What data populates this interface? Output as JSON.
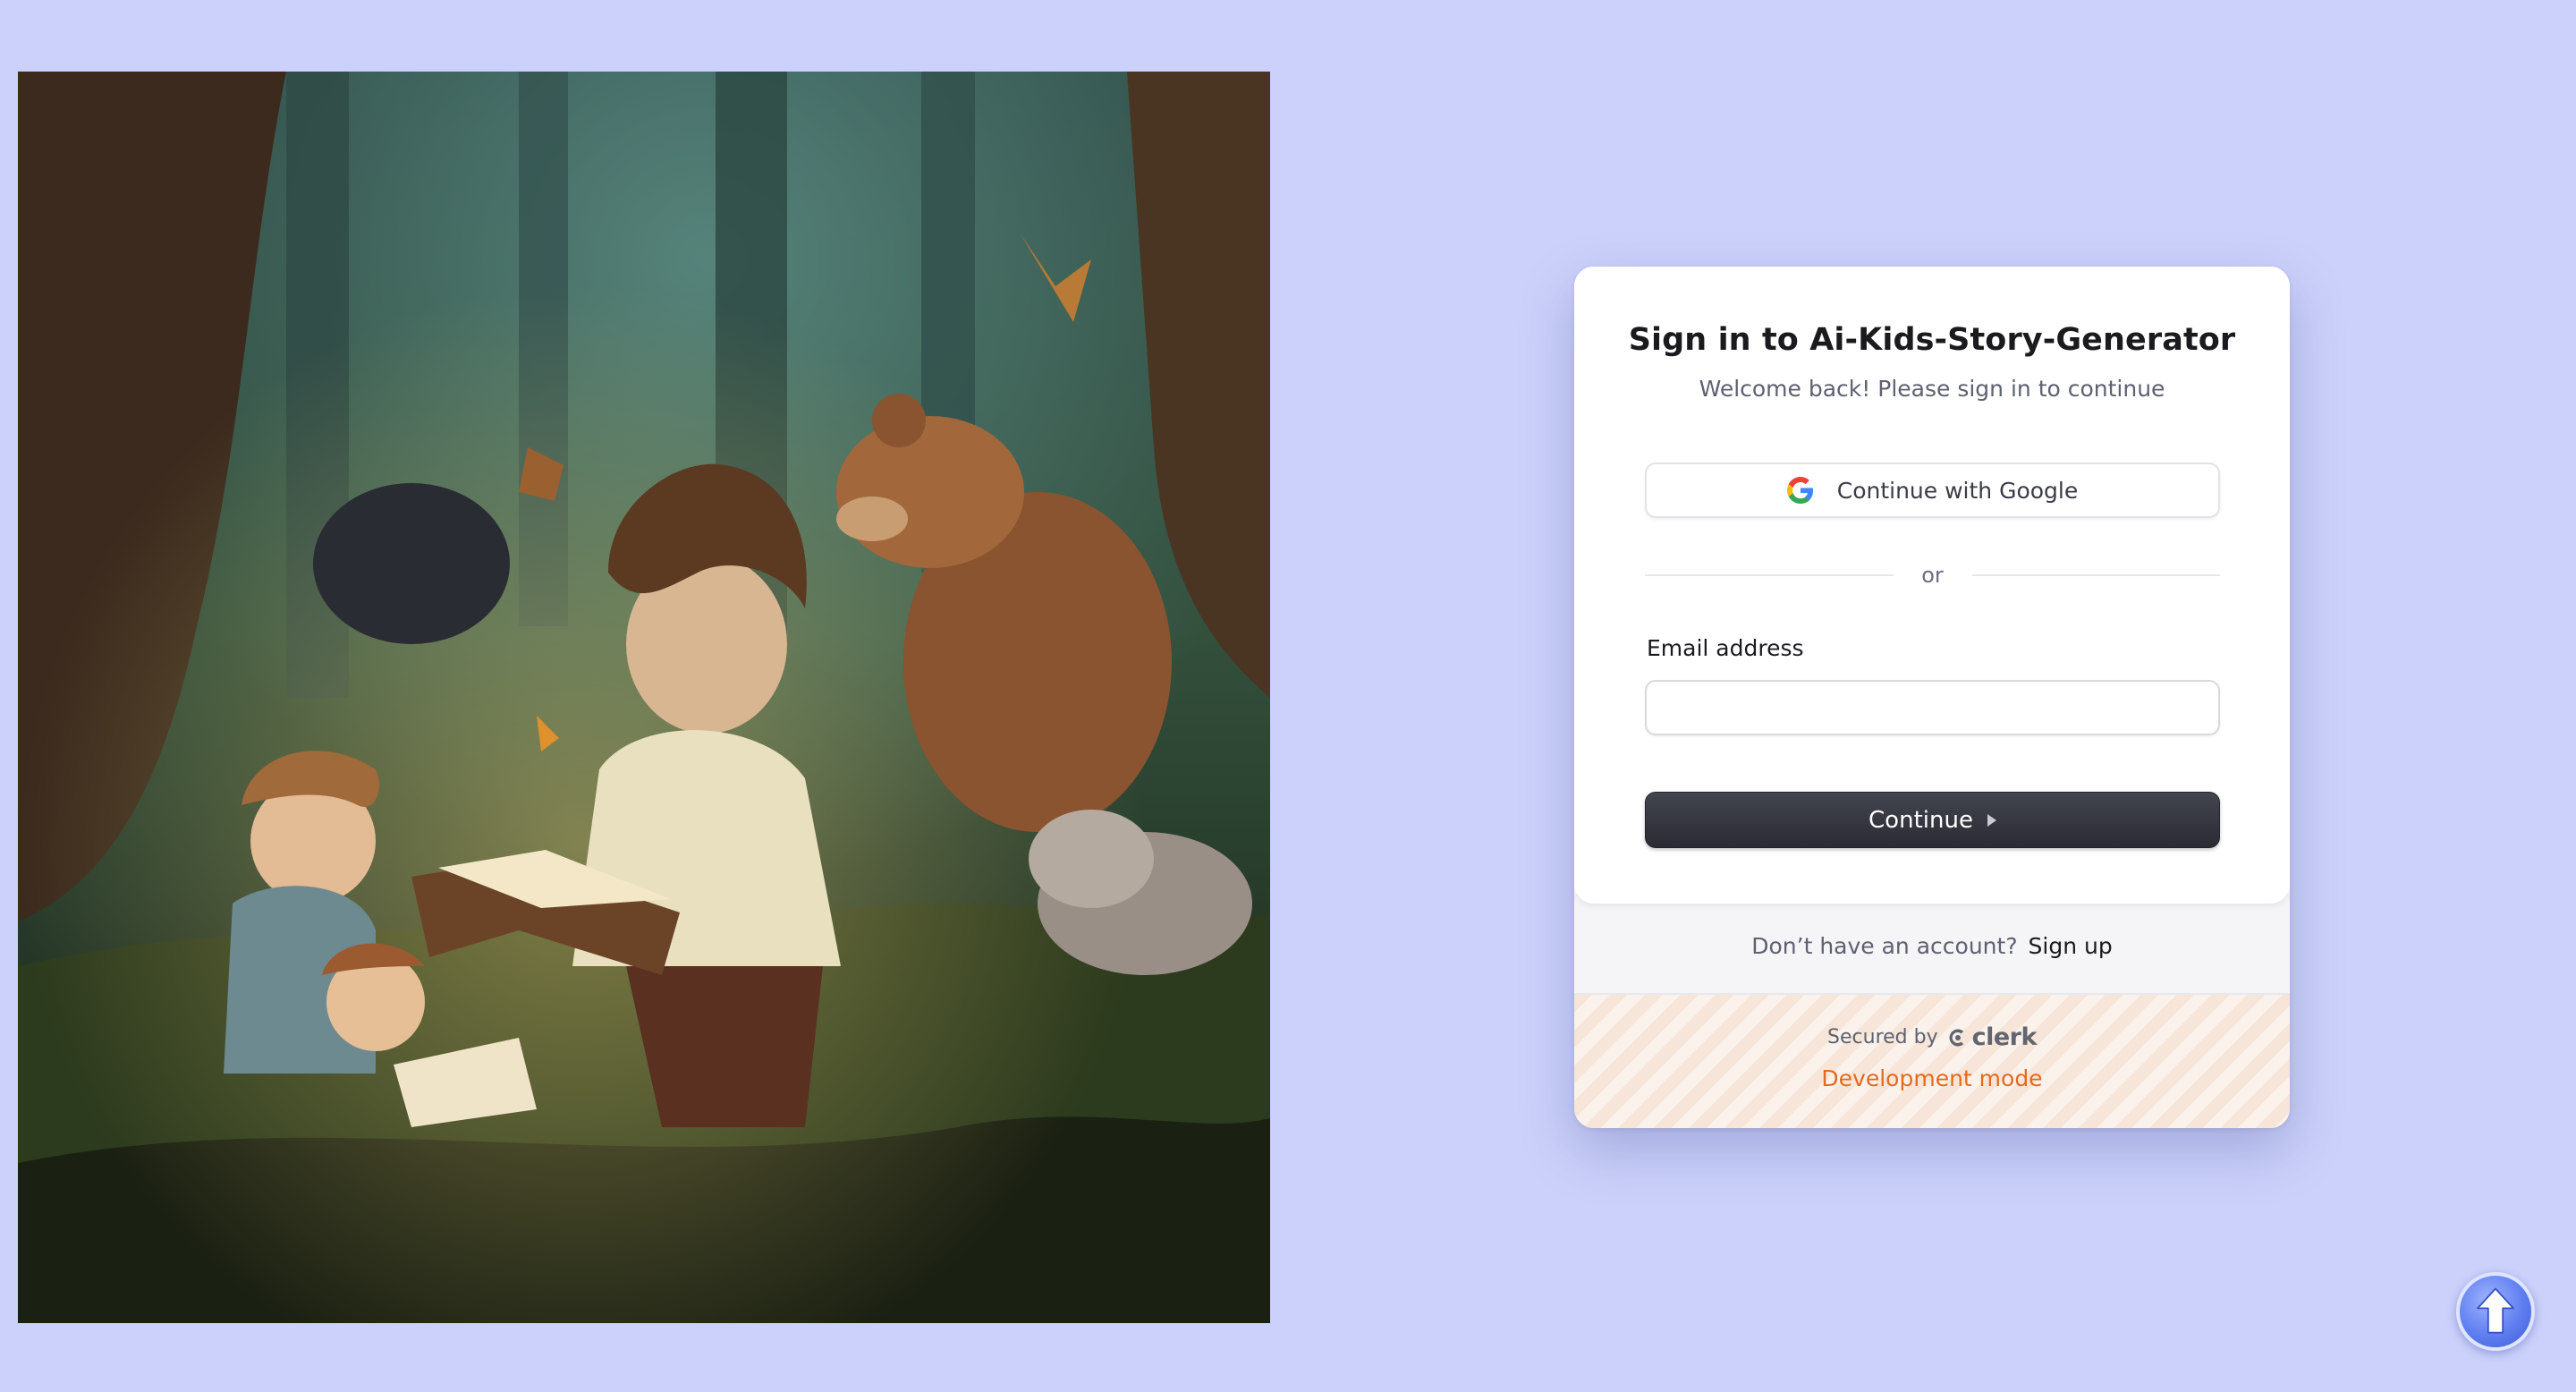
{
  "hero": {
    "image_description_icon": "storybook-forest-illustration"
  },
  "signin": {
    "title": "Sign in to Ai-Kids-Story-Generator",
    "subtitle": "Welcome back! Please sign in to continue",
    "google_label": "Continue with Google",
    "divider_text": "or",
    "email_label": "Email address",
    "email_value": "",
    "continue_label": "Continue",
    "signup_question": "Don’t have an account?",
    "signup_link": "Sign up",
    "secured_by": "Secured by",
    "clerk_brand": "clerk",
    "dev_mode": "Development mode"
  },
  "colors": {
    "page_background": "#cbd1fa",
    "primary_button": "#2f3038",
    "dev_mode_accent": "#e36a1e"
  },
  "floating": {
    "scroll_top_icon": "arrow-up-icon"
  }
}
